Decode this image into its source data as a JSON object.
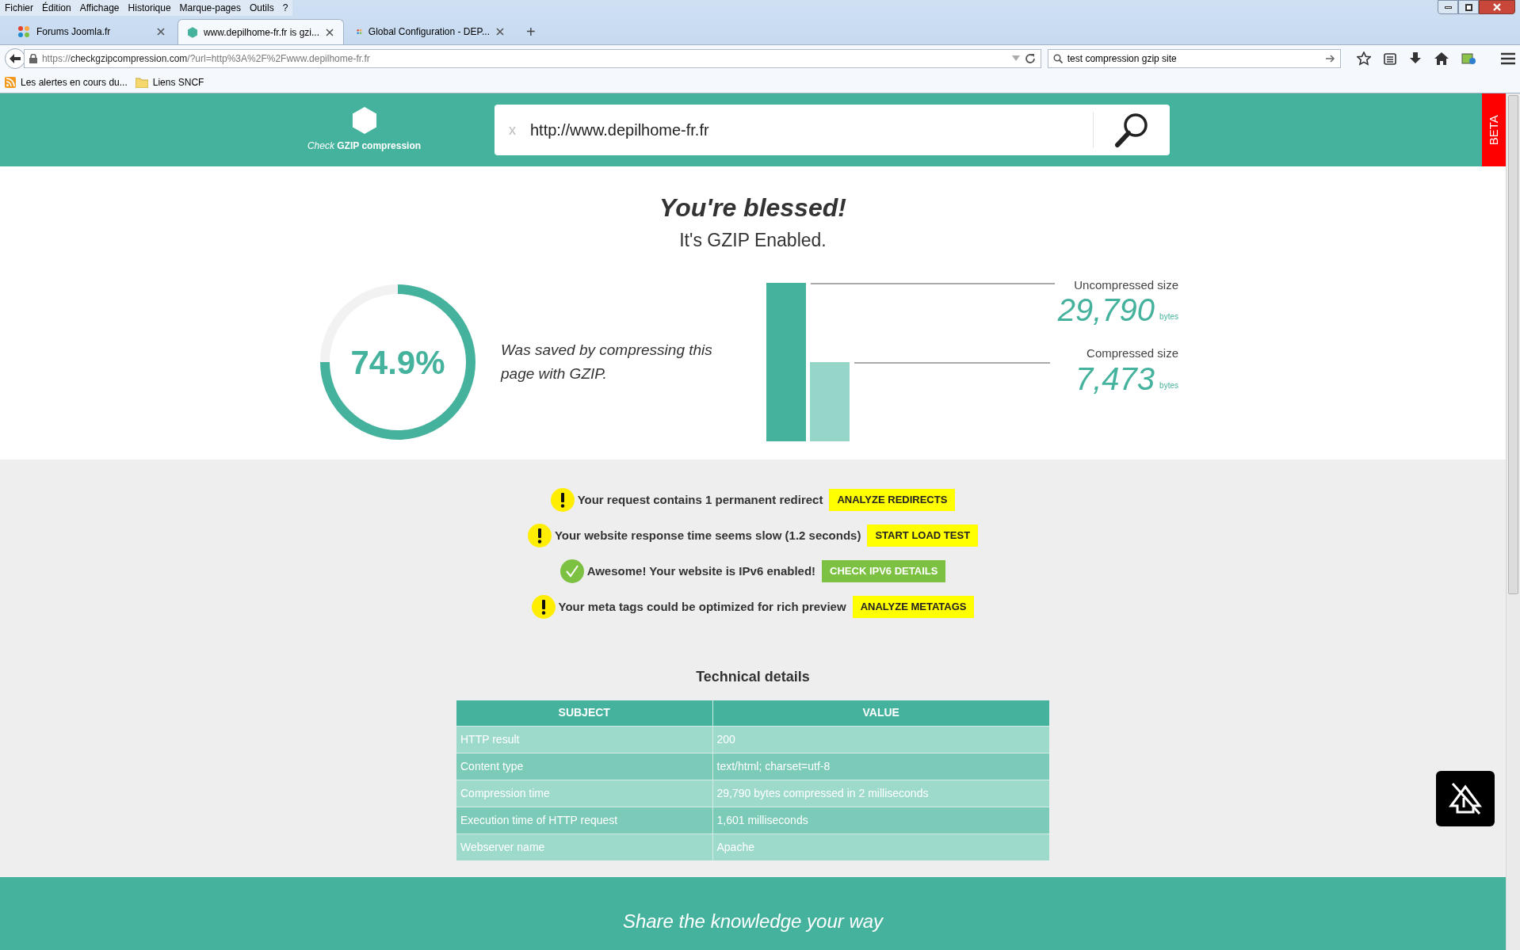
{
  "menu": [
    "Fichier",
    "Édition",
    "Affichage",
    "Historique",
    "Marque-pages",
    "Outils",
    "?"
  ],
  "tabs": [
    {
      "label": "Forums Joomla.fr",
      "selected": false,
      "kind": "joomla"
    },
    {
      "label": "www.depilhome-fr.fr is gzi...",
      "selected": true,
      "kind": "hexagon"
    },
    {
      "label": "Global Configuration - DEP...",
      "selected": false,
      "kind": "joomla"
    }
  ],
  "new_tab": "+",
  "address": {
    "scheme": "https://",
    "host": "checkgzipcompression.com",
    "rest": "/?url=http%3A%2F%2Fwww.depilhome-fr.fr"
  },
  "browser_search": {
    "value": "test compression gzip site"
  },
  "bookmarks": [
    {
      "label": "Les alertes en cours du...",
      "kind": "feed"
    },
    {
      "label": "Liens SNCF",
      "kind": "folder"
    }
  ],
  "site_header": {
    "logo_prefix": "Check",
    "logo_name": "GZIP compression",
    "clear": "x",
    "search_value": "http://www.depilhome-fr.fr",
    "beta": "BETA"
  },
  "result": {
    "title": "You're blessed!",
    "subtitle": "It's GZIP Enabled.",
    "saved": {
      "reading": "74.9%",
      "level": 0.749
    },
    "caption": "Was saved by compressing this page with GZIP.",
    "sizes": [
      {
        "label": "Uncompressed size",
        "value": "29,790",
        "unit": "bytes"
      },
      {
        "label": "Compressed size",
        "value": "7,473",
        "unit": "bytes"
      }
    ]
  },
  "notices": [
    {
      "kind": "warning",
      "text": "Your request contains 1 permanent redirect",
      "action": "ANALYZE REDIRECTS"
    },
    {
      "kind": "warning",
      "text": "Your website response time seems slow (1.2 seconds)",
      "action": "START LOAD TEST"
    },
    {
      "kind": "success",
      "text": "Awesome! Your website is IPv6 enabled!",
      "action": "CHECK IPV6 DETAILS"
    },
    {
      "kind": "warning",
      "text": "Your meta tags could be optimized for rich preview",
      "action": "ANALYZE METATAGS"
    }
  ],
  "technical": {
    "title": "Technical details",
    "columns": [
      "SUBJECT",
      "VALUE"
    ],
    "rows": [
      [
        "HTTP result",
        "200"
      ],
      [
        "Content type",
        "text/html; charset=utf-8"
      ],
      [
        "Compression time",
        "29,790 bytes compressed in 2 milliseconds"
      ],
      [
        "Execution time of HTTP request",
        "1,601 milliseconds"
      ],
      [
        "Webserver name",
        "Apache"
      ]
    ]
  },
  "footer": {
    "tagline": "Share the knowledge your way"
  }
}
